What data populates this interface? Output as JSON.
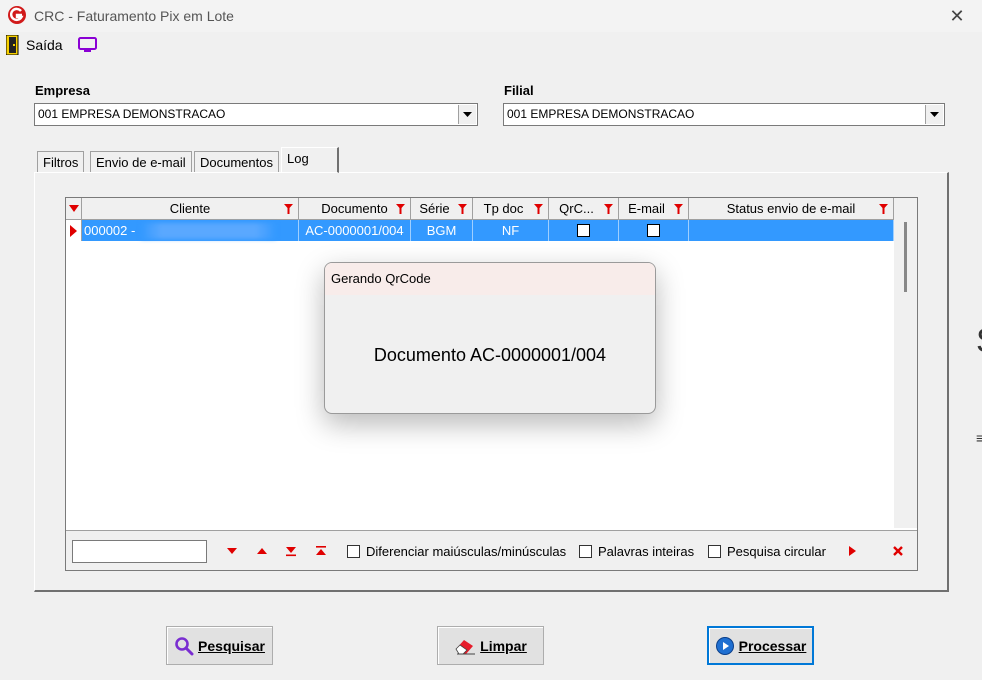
{
  "window": {
    "title": "CRC - Faturamento Pix em Lote",
    "app_icon": "crc-logo-icon",
    "close_icon": "close-icon"
  },
  "toolbar": {
    "exit_label": "Saída",
    "exit_icon": "exit-door-icon",
    "monitor_icon": "monitor-icon"
  },
  "form": {
    "empresa_label": "Empresa",
    "empresa_value": "001 EMPRESA DEMONSTRACAO",
    "filial_label": "Filial",
    "filial_value": "001 EMPRESA DEMONSTRACAO"
  },
  "tabs": [
    {
      "label": "Filtros"
    },
    {
      "label": "Envio de e-mail"
    },
    {
      "label": "Documentos"
    },
    {
      "label": "Log"
    }
  ],
  "grid": {
    "columns": [
      "Cliente",
      "Documento",
      "Série",
      "Tp doc",
      "QrC...",
      "E-mail",
      "Status envio de e-mail"
    ],
    "rows": [
      {
        "cliente": "000002 -",
        "documento": "AC-0000001/004",
        "serie": "BGM",
        "tp_doc": "NF",
        "qrcode": false,
        "email": false,
        "status": ""
      }
    ]
  },
  "search": {
    "input_value": "",
    "opt_case": "Diferenciar maiúsculas/minúsculas",
    "opt_words": "Palavras inteiras",
    "opt_circular": "Pesquisa circular"
  },
  "dialog": {
    "title": "Gerando QrCode",
    "message": "Documento AC-0000001/004"
  },
  "buttons": {
    "pesquisar": "Pesquisar",
    "limpar": "Limpar",
    "processar": "Processar"
  },
  "colors": {
    "selection": "#3399ff",
    "filter_red": "#e00000",
    "accent_blue": "#0078d7"
  }
}
